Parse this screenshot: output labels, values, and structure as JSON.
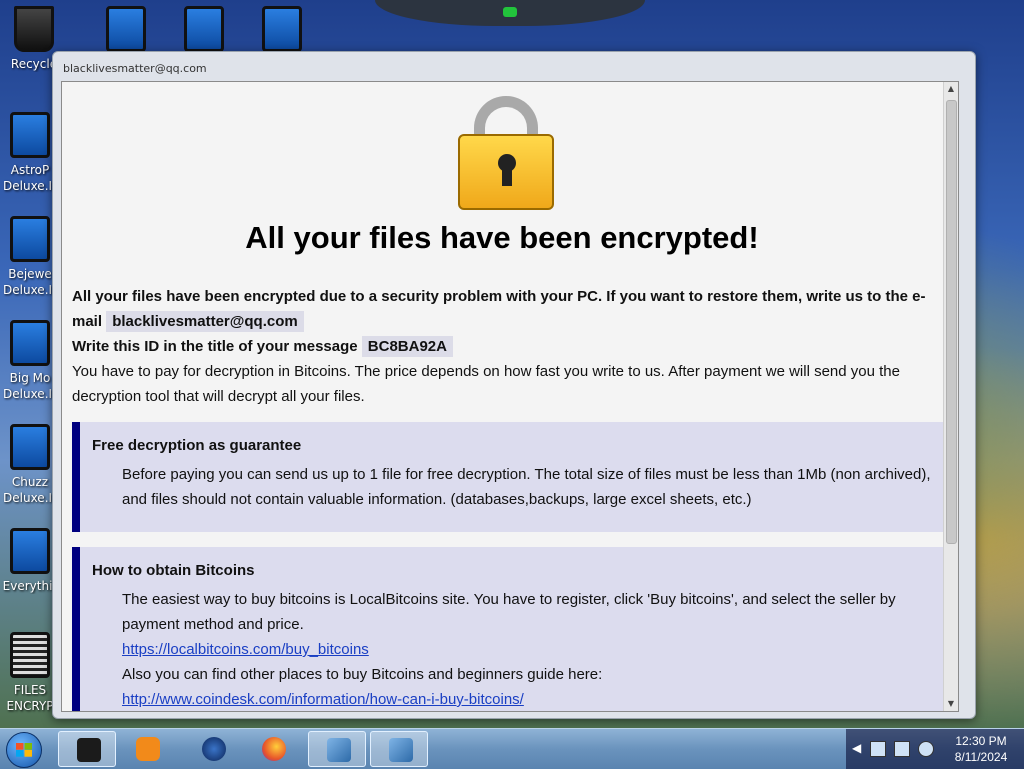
{
  "desktop": {
    "icons": [
      {
        "label": "Recycle"
      },
      {
        "label": "AstroP Deluxe.Ir"
      },
      {
        "label": "Bejewe Deluxe.Ir"
      },
      {
        "label": "Big Mo Deluxe.Ir"
      },
      {
        "label": "Chuzz Deluxe.Ir"
      },
      {
        "label": "Everythir"
      },
      {
        "label": "FILES ENCRYP"
      }
    ]
  },
  "window": {
    "title": "blacklivesmatter@qq.com",
    "heading": "All your files have been encrypted!",
    "intro_bold_1": "All your files have been encrypted due to a security problem with your PC. If you want to restore them, write us to the e-mail",
    "email": "blacklivesmatter@qq.com",
    "intro_bold_2": "Write this ID in the title of your message",
    "id_code": "BC8BA92A",
    "intro_text": "You have to pay for decryption in Bitcoins. The price depends on how fast you write to us. After payment we will send you the decryption tool that will decrypt all your files.",
    "box1": {
      "title": "Free decryption as guarantee",
      "text": "Before paying you can send us up to 1 file for free decryption. The total size of files must be less than 1Mb (non archived), and files should not contain valuable information. (databases,backups, large excel sheets, etc.)"
    },
    "box2": {
      "title": "How to obtain Bitcoins",
      "text1": "The easiest way to buy bitcoins is LocalBitcoins site. You have to register, click 'Buy bitcoins', and select the seller by payment method and price.",
      "link1": "https://localbitcoins.com/buy_bitcoins",
      "text2": "Also you can find other places to buy Bitcoins and beginners guide here:",
      "link2": "http://www.coindesk.com/information/how-can-i-buy-bitcoins/"
    }
  },
  "taskbar": {
    "time": "12:30 PM",
    "date": "8/11/2024",
    "apps": [
      "terminal-icon",
      "media-player-icon",
      "globe-icon",
      "firefox-icon",
      "installer-icon",
      "installer-icon"
    ]
  }
}
